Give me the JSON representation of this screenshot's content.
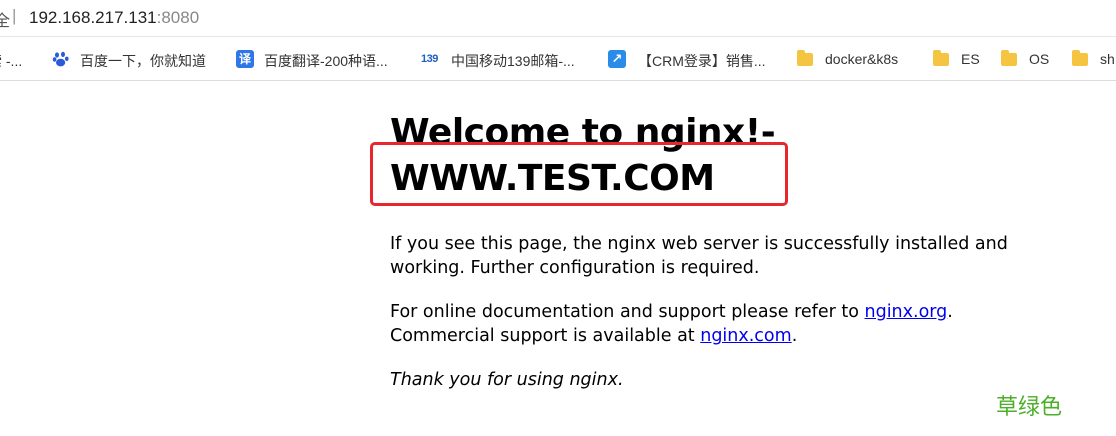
{
  "address_bar": {
    "left_glyph": "全",
    "separator": "|",
    "host": "192.168.217.131",
    "port": ":8080"
  },
  "bookmarks": [
    {
      "label": "索 -...",
      "icon": "none"
    },
    {
      "label": "百度一下，你就知道",
      "icon": "baidu-paw-icon"
    },
    {
      "label": "百度翻译-200种语...",
      "icon": "fanyi-icon",
      "icon_text": "译"
    },
    {
      "label": "中国移动139邮箱-...",
      "icon": "mail-139-icon",
      "icon_text": "139"
    },
    {
      "label": "【CRM登录】销售...",
      "icon": "crm-arrow-icon",
      "icon_text": "↗"
    },
    {
      "label": "docker&k8s",
      "icon": "folder-icon"
    },
    {
      "label": "ES",
      "icon": "folder-icon"
    },
    {
      "label": "OS",
      "icon": "folder-icon"
    },
    {
      "label": "sh",
      "icon": "folder-icon"
    }
  ],
  "page": {
    "heading_line1": "Welcome to nginx!-",
    "heading_line2": "WWW.TEST.COM",
    "para1": "If you see this page, the nginx web server is successfully installed and working. Further configuration is required.",
    "para2_pre": "For online documentation and support please refer to ",
    "para2_link1": "nginx.org",
    "para2_mid": ".",
    "para2_line2_pre": "Commercial support is available at ",
    "para2_link2": "nginx.com",
    "para2_end": ".",
    "para3": "Thank you for using nginx."
  },
  "annotation": {
    "caption": "草绿色",
    "box_color": "#e8262b",
    "caption_color": "#4caf28"
  }
}
